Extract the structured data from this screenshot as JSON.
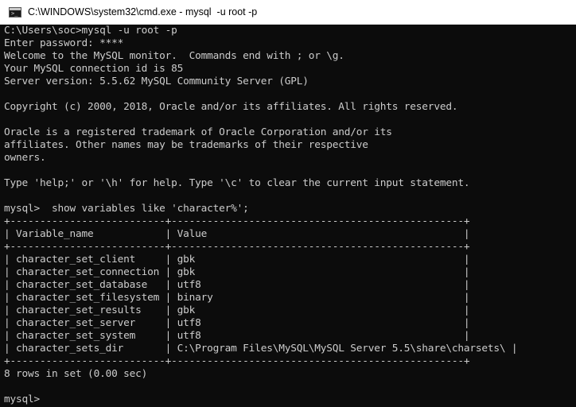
{
  "window": {
    "title": "C:\\WINDOWS\\system32\\cmd.exe - mysql  -u root -p",
    "icon": "cmd-icon",
    "icon_glyph": ">_"
  },
  "colors": {
    "background": "#0c0c0c",
    "text": "#cccccc",
    "titlebar": "#ffffff"
  },
  "console": {
    "lines": [
      "C:\\Users\\soc>mysql -u root -p",
      "Enter password: ****",
      "Welcome to the MySQL monitor.  Commands end with ; or \\g.",
      "Your MySQL connection id is 85",
      "Server version: 5.5.62 MySQL Community Server (GPL)",
      "",
      "Copyright (c) 2000, 2018, Oracle and/or its affiliates. All rights reserved.",
      "",
      "Oracle is a registered trademark of Oracle Corporation and/or its",
      "affiliates. Other names may be trademarks of their respective",
      "owners.",
      "",
      "Type 'help;' or '\\h' for help. Type '\\c' to clear the current input statement.",
      "",
      "mysql>  show variables like 'character%';",
      "+--------------------------+-------------------------------------------------+",
      "| Variable_name            | Value                                           |",
      "+--------------------------+-------------------------------------------------+",
      "| character_set_client     | gbk                                             |",
      "| character_set_connection | gbk                                             |",
      "| character_set_database   | utf8                                            |",
      "| character_set_filesystem | binary                                          |",
      "| character_set_results    | gbk                                             |",
      "| character_set_server     | utf8                                            |",
      "| character_set_system     | utf8                                            |",
      "| character_sets_dir       | C:\\Program Files\\MySQL\\MySQL Server 5.5\\share\\charsets\\ |",
      "+--------------------------+-------------------------------------------------+",
      "8 rows in set (0.00 sec)",
      "",
      "mysql> "
    ]
  }
}
